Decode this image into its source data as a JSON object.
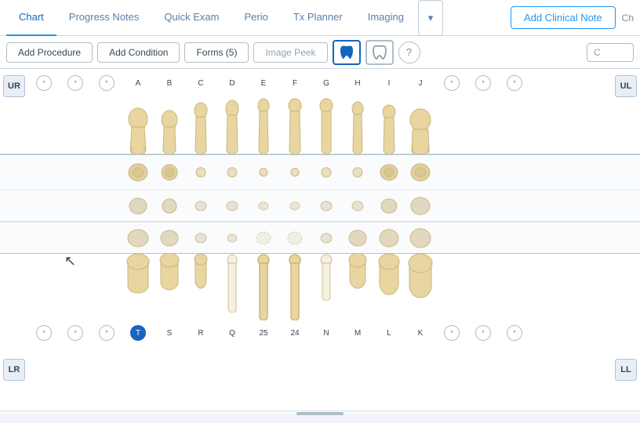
{
  "tabs": [
    {
      "id": "chart",
      "label": "Chart",
      "active": true
    },
    {
      "id": "progress-notes",
      "label": "Progress Notes",
      "active": false
    },
    {
      "id": "quick-exam",
      "label": "Quick Exam",
      "active": false
    },
    {
      "id": "perio",
      "label": "Perio",
      "active": false
    },
    {
      "id": "tx-planner",
      "label": "Tx Planner",
      "active": false
    },
    {
      "id": "imaging",
      "label": "Imaging",
      "active": false
    }
  ],
  "more_tabs_label": "▾",
  "add_clinical_note_label": "Add Clinical Note",
  "toolbar": {
    "add_procedure": "Add Procedure",
    "add_condition": "Add Condition",
    "forms": "Forms (5)",
    "image_peek": "Image Peek",
    "help": "?"
  },
  "quadrants": {
    "ur": "UR",
    "ul": "UL",
    "lr": "LR",
    "ll": "LL"
  },
  "upper_teeth_labels": [
    "*",
    "*",
    "*",
    "A",
    "B",
    "C",
    "D",
    "E",
    "F",
    "G",
    "H",
    "I",
    "J",
    "*",
    "*",
    "*"
  ],
  "lower_teeth_labels": [
    "*",
    "*",
    "*",
    "T",
    "S",
    "R",
    "Q",
    "25",
    "24",
    "N",
    "M",
    "L",
    "K",
    "*",
    "*",
    "*"
  ],
  "scroll_bar": true
}
